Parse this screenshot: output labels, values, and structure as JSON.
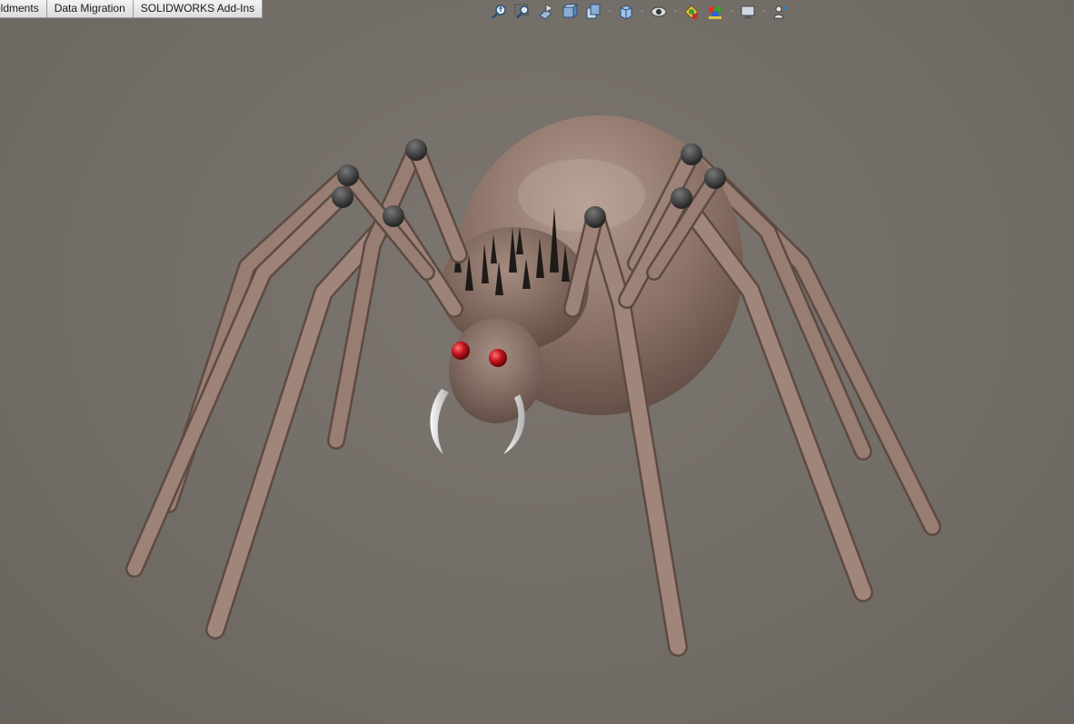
{
  "command_manager": {
    "tabs": [
      {
        "label": "eldments"
      },
      {
        "label": "Data Migration"
      },
      {
        "label": "SOLIDWORKS Add-Ins"
      }
    ]
  },
  "heads_up_toolbar": {
    "icons": [
      "zoom-to-fit-icon",
      "zoom-to-area-icon",
      "previous-view-icon",
      "section-view-icon",
      "dynamic-annotation-views-icon",
      "view-orientation-icon",
      "display-style-icon",
      "hide-show-items-icon",
      "edit-appearance-icon",
      "apply-scene-icon",
      "view-settings-icon",
      "rotate-view-icon"
    ]
  },
  "colors": {
    "viewport_background": "#756f69",
    "spider_body": "#9a8175",
    "spider_eye": "#c0141c",
    "fang": "#e8e8e8",
    "leg_joint": "#3a3a3a"
  }
}
